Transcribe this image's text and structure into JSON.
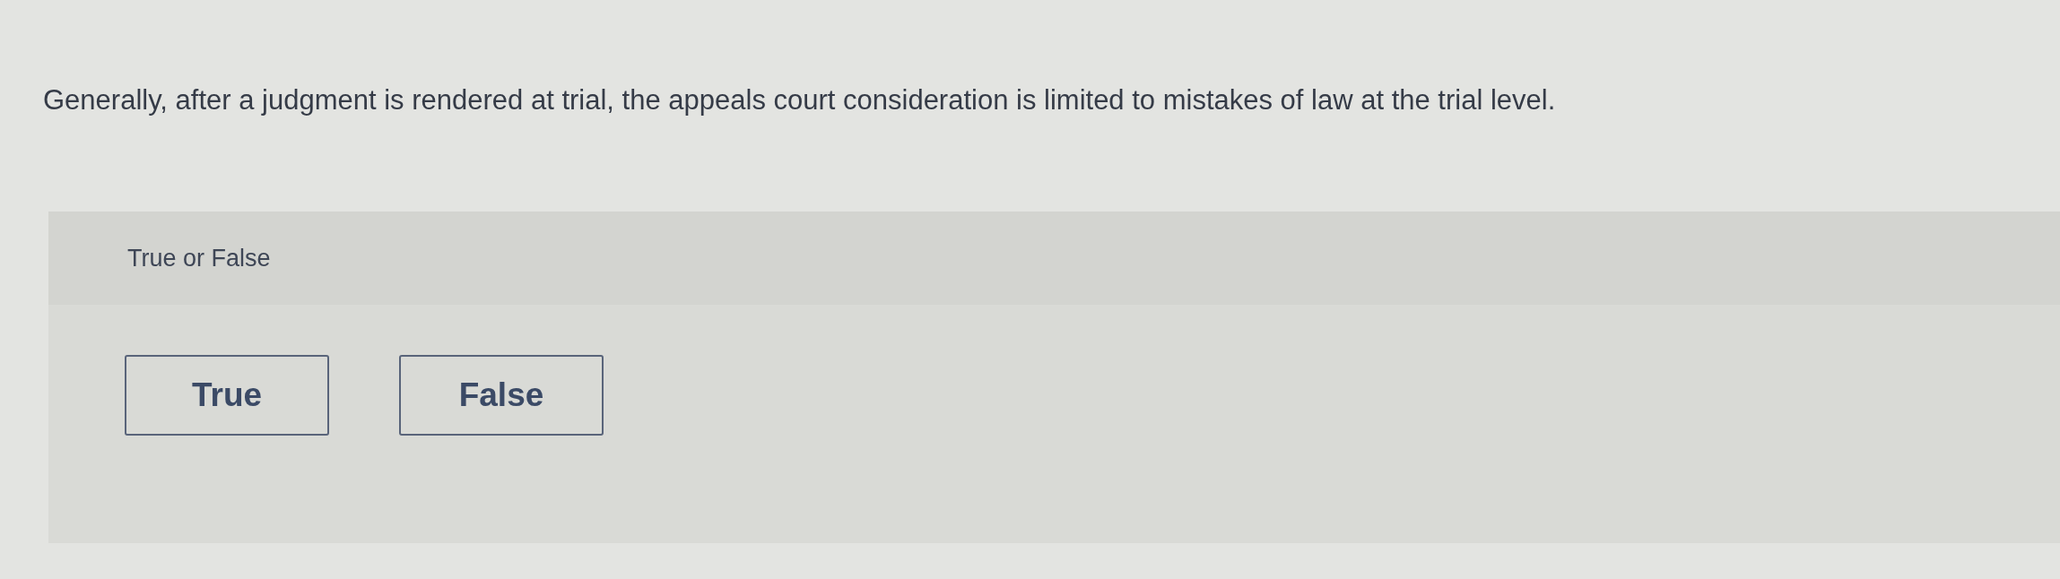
{
  "question": {
    "text": "Generally, after a judgment is rendered at trial, the appeals court consideration is limited to mistakes of law at the trial level."
  },
  "answer_panel": {
    "prompt": "True or False",
    "options": [
      {
        "label": "True",
        "selected": false
      },
      {
        "label": "False",
        "selected": false
      }
    ]
  }
}
